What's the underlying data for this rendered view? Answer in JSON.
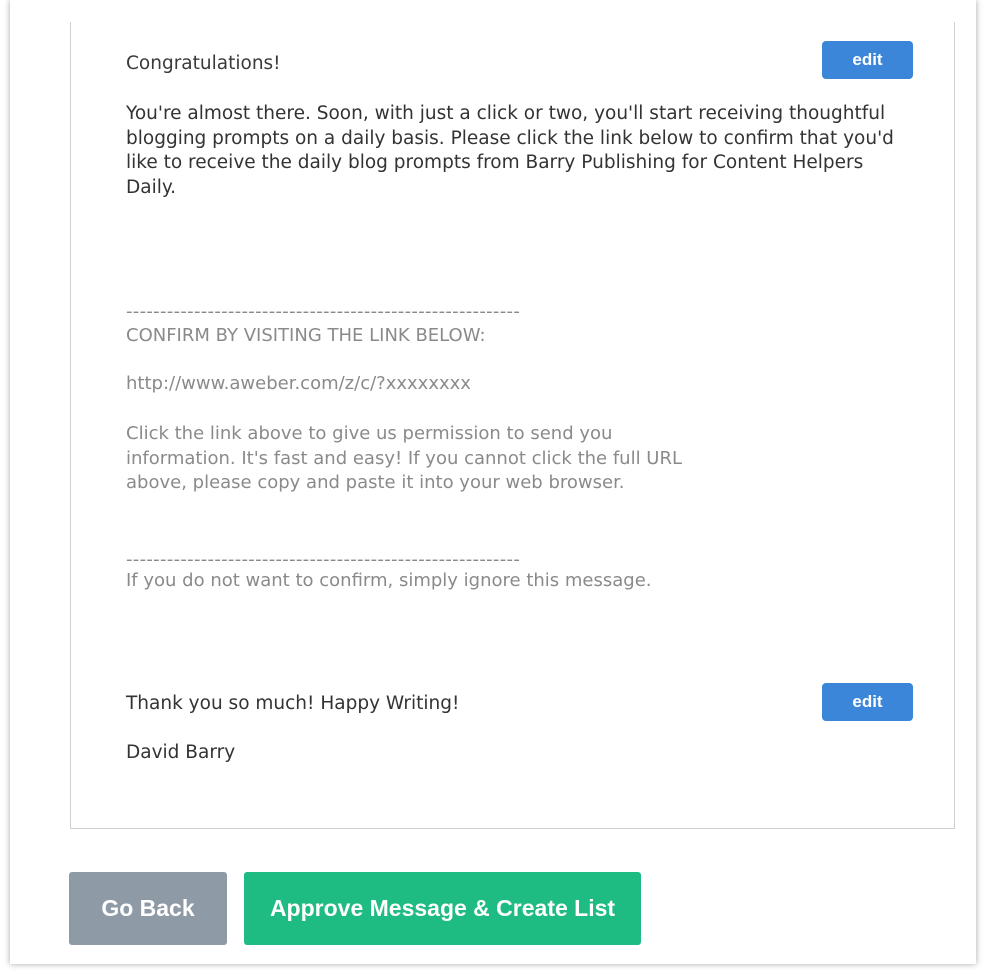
{
  "message": {
    "edit_label": "edit",
    "greeting": "Congratulations!",
    "intro": "You're almost there. Soon, with just a click or two, you'll start receiving thoughtful blogging prompts on a daily basis. Please click the link below to confirm that you'd like to receive the daily blog prompts from Barry Publishing for Content Helpers Daily.",
    "divider": "----------------------------------------------------------",
    "confirm_heading": "CONFIRM BY VISITING THE LINK BELOW:",
    "confirm_link": "http://www.aweber.com/z/c/?xxxxxxxx",
    "confirm_instructions": "Click the link above to give us permission to send you information. It's fast and easy! If you cannot click the full URL above, please copy and paste it into your web browser.",
    "ignore_note": "If you do not want to confirm, simply ignore this message.",
    "closing": "Thank you so much! Happy Writing!",
    "signature": "David Barry"
  },
  "actions": {
    "go_back_label": "Go Back",
    "approve_label": "Approve Message & Create List"
  },
  "colors": {
    "edit_button": "#3b86d8",
    "go_back_button": "#8e9aa6",
    "approve_button": "#1ebc82"
  }
}
